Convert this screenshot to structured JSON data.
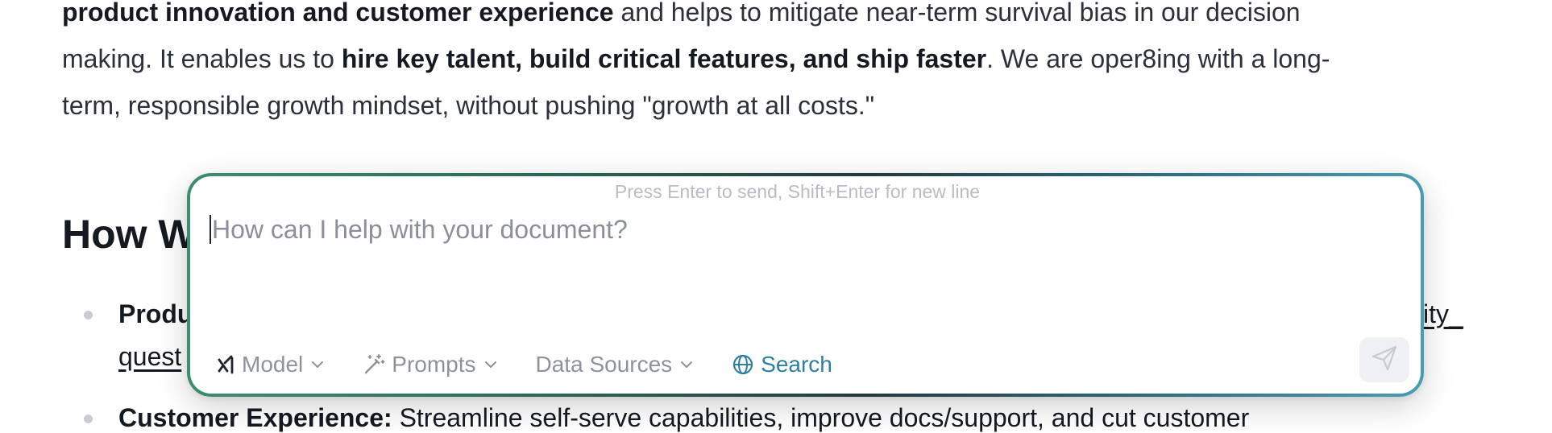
{
  "document": {
    "paragraph": {
      "line1_bold": "product innovation and customer experience",
      "line1_rest": " and helps to mitigate near-term survival bias in our decision",
      "line2_start": "making. It enables us to ",
      "line2_bold": "hire key talent, build critical features, and ship faster",
      "line2_rest": ". We are oper8ing with a long-",
      "line3": "term, responsible growth mindset, without pushing \"growth at all costs.\""
    },
    "heading_visible": "How W",
    "bullets": [
      {
        "left_fragment": "Produ",
        "right_fragment": "ity_",
        "second_line_fragment": "quest"
      },
      {
        "label": "Customer Experience:",
        "text": " Streamline self-serve capabilities, improve docs/support, and cut customer"
      }
    ]
  },
  "chat": {
    "hint": "Press Enter to send, Shift+Enter for new line",
    "placeholder": "How can I help with your document?",
    "toolbar": {
      "model_label": "Model",
      "prompts_label": "Prompts",
      "data_sources_label": "Data Sources",
      "search_label": "Search"
    },
    "colors": {
      "border_gradient": [
        "#3d8e6c",
        "#233a3f",
        "#4b9bb5"
      ],
      "search_accent": "#2f7fa1",
      "hint_text": "#b9bcc4"
    },
    "icons": {
      "model": "xai-logo-icon",
      "prompts": "magic-wand-icon",
      "search": "globe-icon",
      "send": "paper-plane-icon",
      "dropdown": "chevron-down-icon"
    }
  }
}
